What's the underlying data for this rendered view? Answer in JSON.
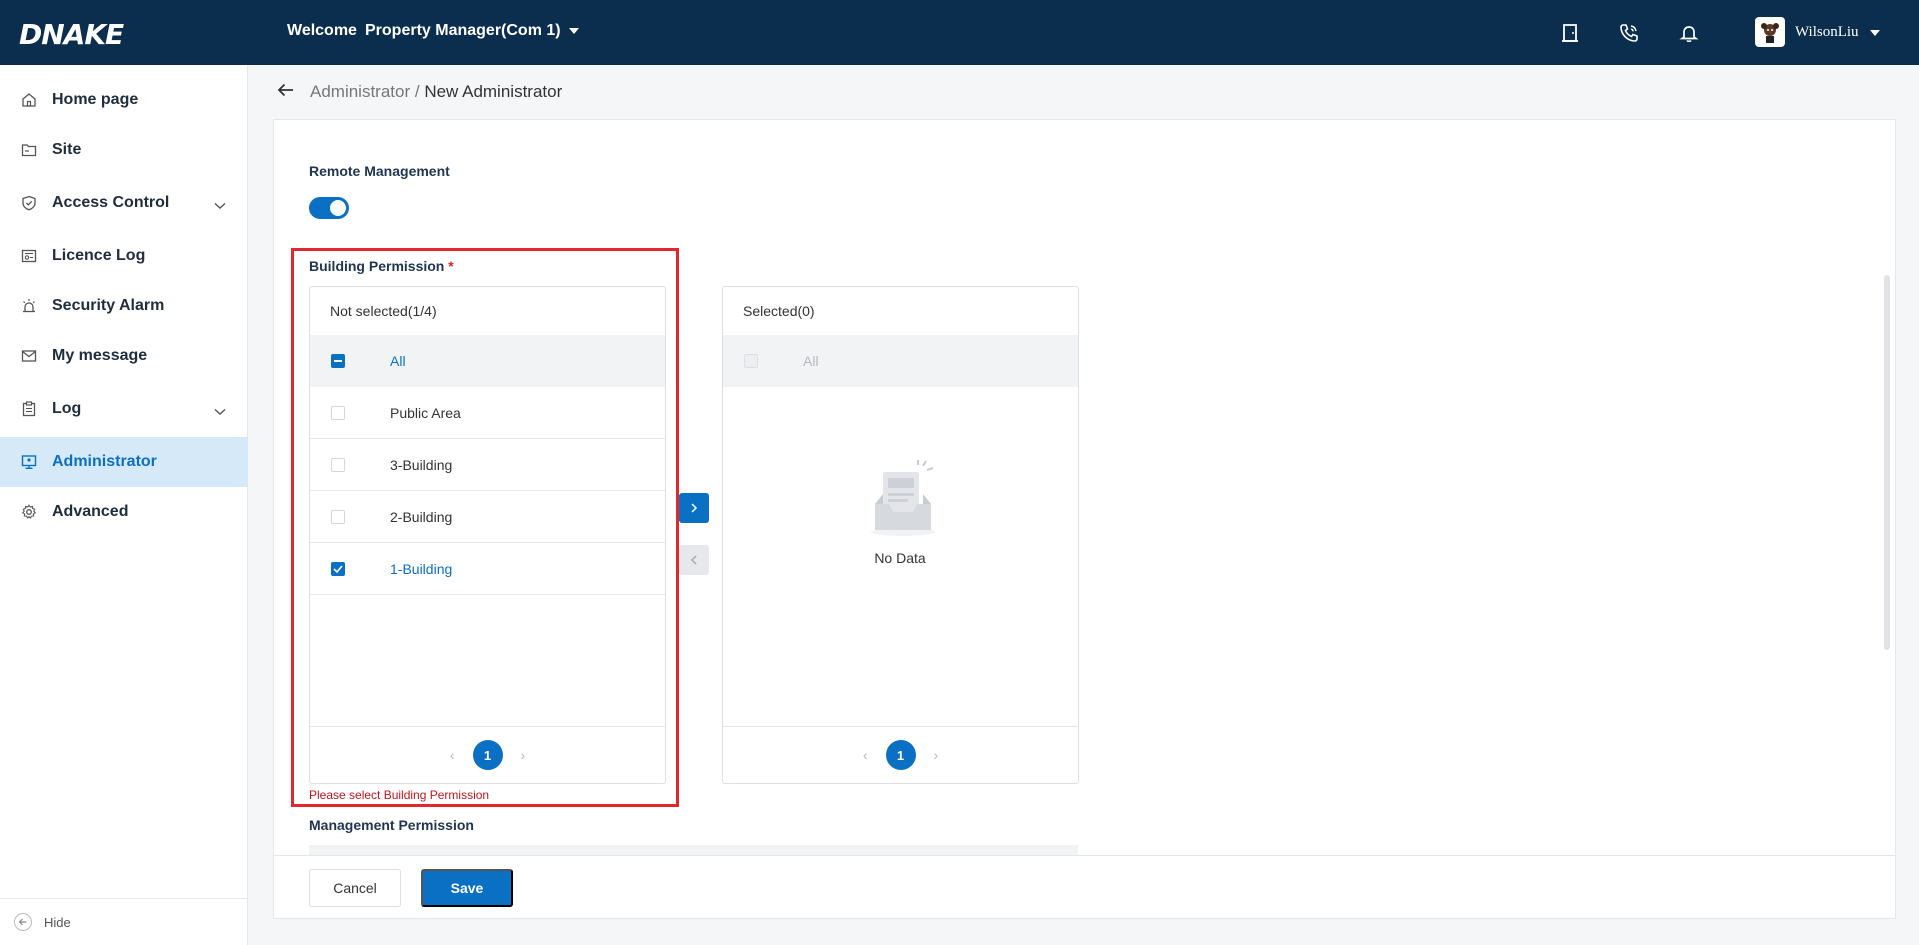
{
  "header": {
    "logo_text_1": "D",
    "logo_text_2": "NAKE",
    "welcome": "Welcome",
    "role": "Property Manager(Com 1)",
    "username": "WilsonLiu"
  },
  "sidebar": {
    "items": [
      {
        "label": "Home page",
        "icon": "home-icon"
      },
      {
        "label": "Site",
        "icon": "folder-icon"
      },
      {
        "label": "Access Control",
        "icon": "shield-icon",
        "expandable": true
      },
      {
        "label": "Licence Log",
        "icon": "licence-icon"
      },
      {
        "label": "Security Alarm",
        "icon": "alarm-icon"
      },
      {
        "label": "My message",
        "icon": "mail-icon"
      },
      {
        "label": "Log",
        "icon": "clipboard-icon",
        "expandable": true
      },
      {
        "label": "Administrator",
        "icon": "monitor-icon",
        "active": true
      },
      {
        "label": "Advanced",
        "icon": "gear-icon"
      }
    ],
    "hide_label": "Hide"
  },
  "breadcrumb": {
    "parent": "Administrator",
    "separator": " / ",
    "current": "New Administrator"
  },
  "form": {
    "remote_management_label": "Remote Management",
    "remote_management_enabled": true,
    "building_permission_label": "Building Permission",
    "required_mark": "*",
    "not_selected_title": "Not selected(1/4)",
    "selected_title": "Selected(0)",
    "all_label": "All",
    "not_selected_items": [
      {
        "label": "Public Area",
        "checked": false
      },
      {
        "label": "3-Building",
        "checked": false
      },
      {
        "label": "2-Building",
        "checked": false
      },
      {
        "label": "1-Building",
        "checked": true
      }
    ],
    "empty_text": "No Data",
    "page_left": "1",
    "page_right": "1",
    "error_text": "Please select Building Permission",
    "management_permission_label": "Management Permission"
  },
  "buttons": {
    "cancel": "Cancel",
    "save": "Save"
  },
  "colors": {
    "header_bg": "#0b2e4f",
    "primary": "#0a70c4",
    "error": "#c0141c",
    "highlight_border": "#e0282e",
    "logo_accent": "#f39a21"
  }
}
